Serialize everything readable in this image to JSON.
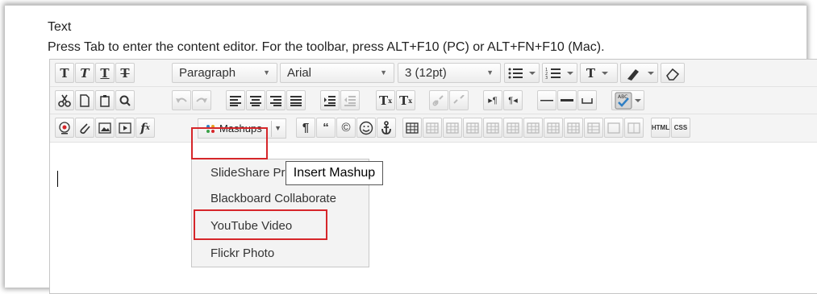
{
  "field_label": "Text",
  "instructions": "Press Tab to enter the content editor. For the toolbar, press ALT+F10 (PC) or ALT+FN+F10 (Mac).",
  "toolbar": {
    "bold": "T",
    "italic": "T",
    "underline": "T",
    "strike": "T",
    "format_select": "Paragraph",
    "font_select": "Arial",
    "size_select": "3 (12pt)",
    "text_color": "T",
    "superscript": "T",
    "subscript": "T",
    "html_button": "HTML",
    "css_button": "CSS",
    "mashups_label": "Mashups",
    "fx": "f",
    "fx_sub": "x",
    "pilcrow": "¶",
    "quote": "“",
    "copyright": "©"
  },
  "tooltip": "Insert Mashup",
  "mashup_menu": {
    "items": [
      "SlideShare Pr",
      "Blackboard Collaborate",
      "YouTube Video",
      "Flickr Photo"
    ]
  },
  "colors": {
    "highlight": "#d6262a"
  }
}
